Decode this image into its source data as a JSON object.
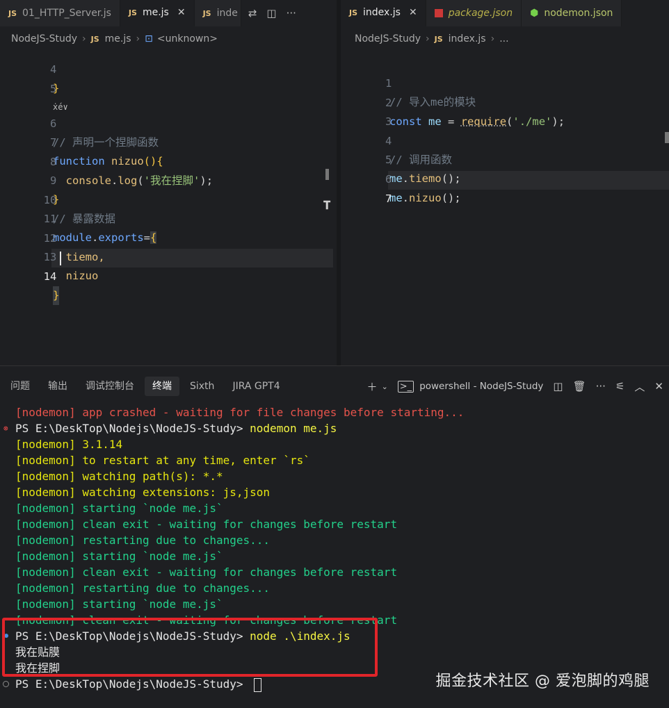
{
  "left_tabs": [
    {
      "icon": "JS",
      "label": "01_HTTP_Server.js",
      "active": false
    },
    {
      "icon": "JS",
      "label": "me.js",
      "active": true
    },
    {
      "icon": "JS",
      "label": "inde",
      "active": false
    }
  ],
  "right_tabs": [
    {
      "icon": "JS",
      "label": "index.js",
      "active": true
    },
    {
      "icon": "pkg",
      "label": "package.json",
      "active": false
    },
    {
      "icon": "nodemon",
      "label": "nodemon.json",
      "active": false
    }
  ],
  "left_breadcrumb": {
    "folder": "NodeJS-Study",
    "file": "me.js",
    "symbol": "<unknown>"
  },
  "right_breadcrumb": {
    "folder": "NodeJS-Study",
    "file": "index.js",
    "more": "..."
  },
  "left_editor": {
    "lines": [
      {
        "num": "4",
        "code": "}"
      },
      {
        "num": "5",
        "code": ""
      },
      {
        "num": "",
        "code": "ẋé∨"
      },
      {
        "num": "6",
        "code": "// 声明一个捏脚函数"
      },
      {
        "num": "7",
        "code": "function nizuo(){"
      },
      {
        "num": "8",
        "code": "  console.log('我在捏脚');"
      },
      {
        "num": "9",
        "code": "}"
      },
      {
        "num": "10",
        "code": "// 暴露数据"
      },
      {
        "num": "11",
        "code": "module.exports={"
      },
      {
        "num": "12",
        "code": "  tiemo,"
      },
      {
        "num": "13",
        "code": "  nizuo"
      },
      {
        "num": "14",
        "code": "}"
      }
    ]
  },
  "right_editor": {
    "lines": [
      {
        "num": "1",
        "code": "// 导入me的模块"
      },
      {
        "num": "2",
        "code": "const me = require('./me');"
      },
      {
        "num": "3",
        "code": ""
      },
      {
        "num": "4",
        "code": "// 调用函数"
      },
      {
        "num": "5",
        "code": "me.tiemo();"
      },
      {
        "num": "6",
        "code": "me.nizuo();"
      },
      {
        "num": "7",
        "code": ""
      }
    ]
  },
  "panel": {
    "tabs": [
      "问题",
      "输出",
      "调试控制台",
      "终端",
      "Sixth",
      "JIRA GPT4"
    ],
    "active_tab": "终端",
    "terminal_name": "powershell - NodeJS-Study"
  },
  "terminal": {
    "lines": [
      "[nodemon] app crashed - waiting for file changes before starting...",
      "PS E:\\DeskTop\\Nodejs\\NodeJS-Study> ",
      "[nodemon] 3.1.14",
      "[nodemon] to restart at any time, enter `rs`",
      "[nodemon] watching path(s): *.*",
      "[nodemon] watching extensions: js,json",
      "[nodemon] starting `node me.js`",
      "[nodemon] clean exit - waiting for changes before restart",
      "[nodemon] restarting due to changes...",
      "[nodemon] starting `node me.js`",
      "[nodemon] clean exit - waiting for changes before restart",
      "[nodemon] restarting due to changes...",
      "[nodemon] starting `node me.js`",
      "[nodemon] clean exit - waiting for changes before restart",
      "PS E:\\DeskTop\\Nodejs\\NodeJS-Study> ",
      "我在贴膜",
      "我在捏脚",
      "PS E:\\DeskTop\\Nodejs\\NodeJS-Study> "
    ],
    "cmd1": "nodemon me.js",
    "cmd2": "node .\\index.js"
  },
  "watermark": "掘金技术社区 @ 爱泡脚的鸡腿",
  "colors": {
    "annotation_box": "#e0252a",
    "background": "#1e1f22"
  }
}
